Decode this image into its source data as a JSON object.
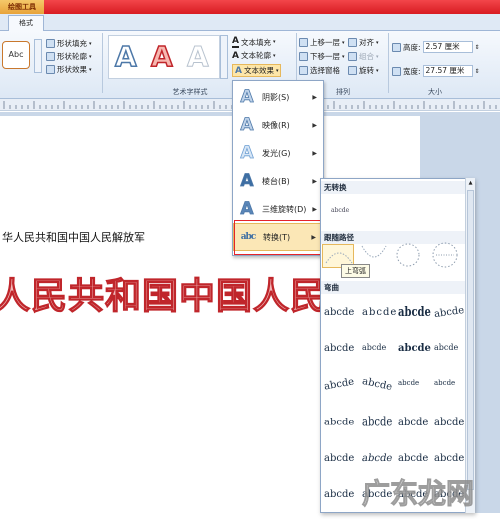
{
  "tabs": {
    "tools_label": "绘图工具",
    "format_label": "格式"
  },
  "ribbon": {
    "shape_sample": "Abc",
    "shape_fill": "形状填充",
    "shape_outline": "形状轮廓",
    "shape_effect": "形状效果",
    "wordart_samples": [
      "A",
      "A",
      "A"
    ],
    "wordart_group_label": "艺术字样式",
    "text_fill": "文本填充",
    "text_outline": "文本轮廓",
    "text_effect": "文本效果",
    "bring_forward": "上移一层",
    "send_backward": "下移一层",
    "selection_pane": "选择窗格",
    "align": "对齐",
    "group": "组合",
    "rotate": "旋转",
    "arrange_group_label": "排列",
    "height_label": "高度:",
    "height_value": "2.57 厘米",
    "width_label": "宽度:",
    "width_value": "27.57 厘米",
    "size_group_label": "大小"
  },
  "document": {
    "body_text": "华人民共和国中国人民解放军",
    "wordart_text": "人民共和国中国人民解放军"
  },
  "effects_menu": {
    "items": [
      {
        "label": "阴影(S)",
        "icon": "A"
      },
      {
        "label": "映像(R)",
        "icon": "A"
      },
      {
        "label": "发光(G)",
        "icon": "A"
      },
      {
        "label": "棱台(B)",
        "icon": "A"
      },
      {
        "label": "三维旋转(D)",
        "icon": "A"
      },
      {
        "label": "转换(T)",
        "icon": "abc-arch"
      }
    ]
  },
  "transform_panel": {
    "no_transform_label": "无转换",
    "no_transform_sample": "abcde",
    "follow_path_label": "跟随路径",
    "warp_label": "弯曲",
    "tooltip": "上弯弧",
    "sample_text": "abcde"
  },
  "watermark": "广东龙网",
  "colors": {
    "title_red": "#d81c22",
    "wordart_stroke": "#c0262b",
    "menu_highlight": "#fbe7b6",
    "red_box": "#e4232b"
  }
}
